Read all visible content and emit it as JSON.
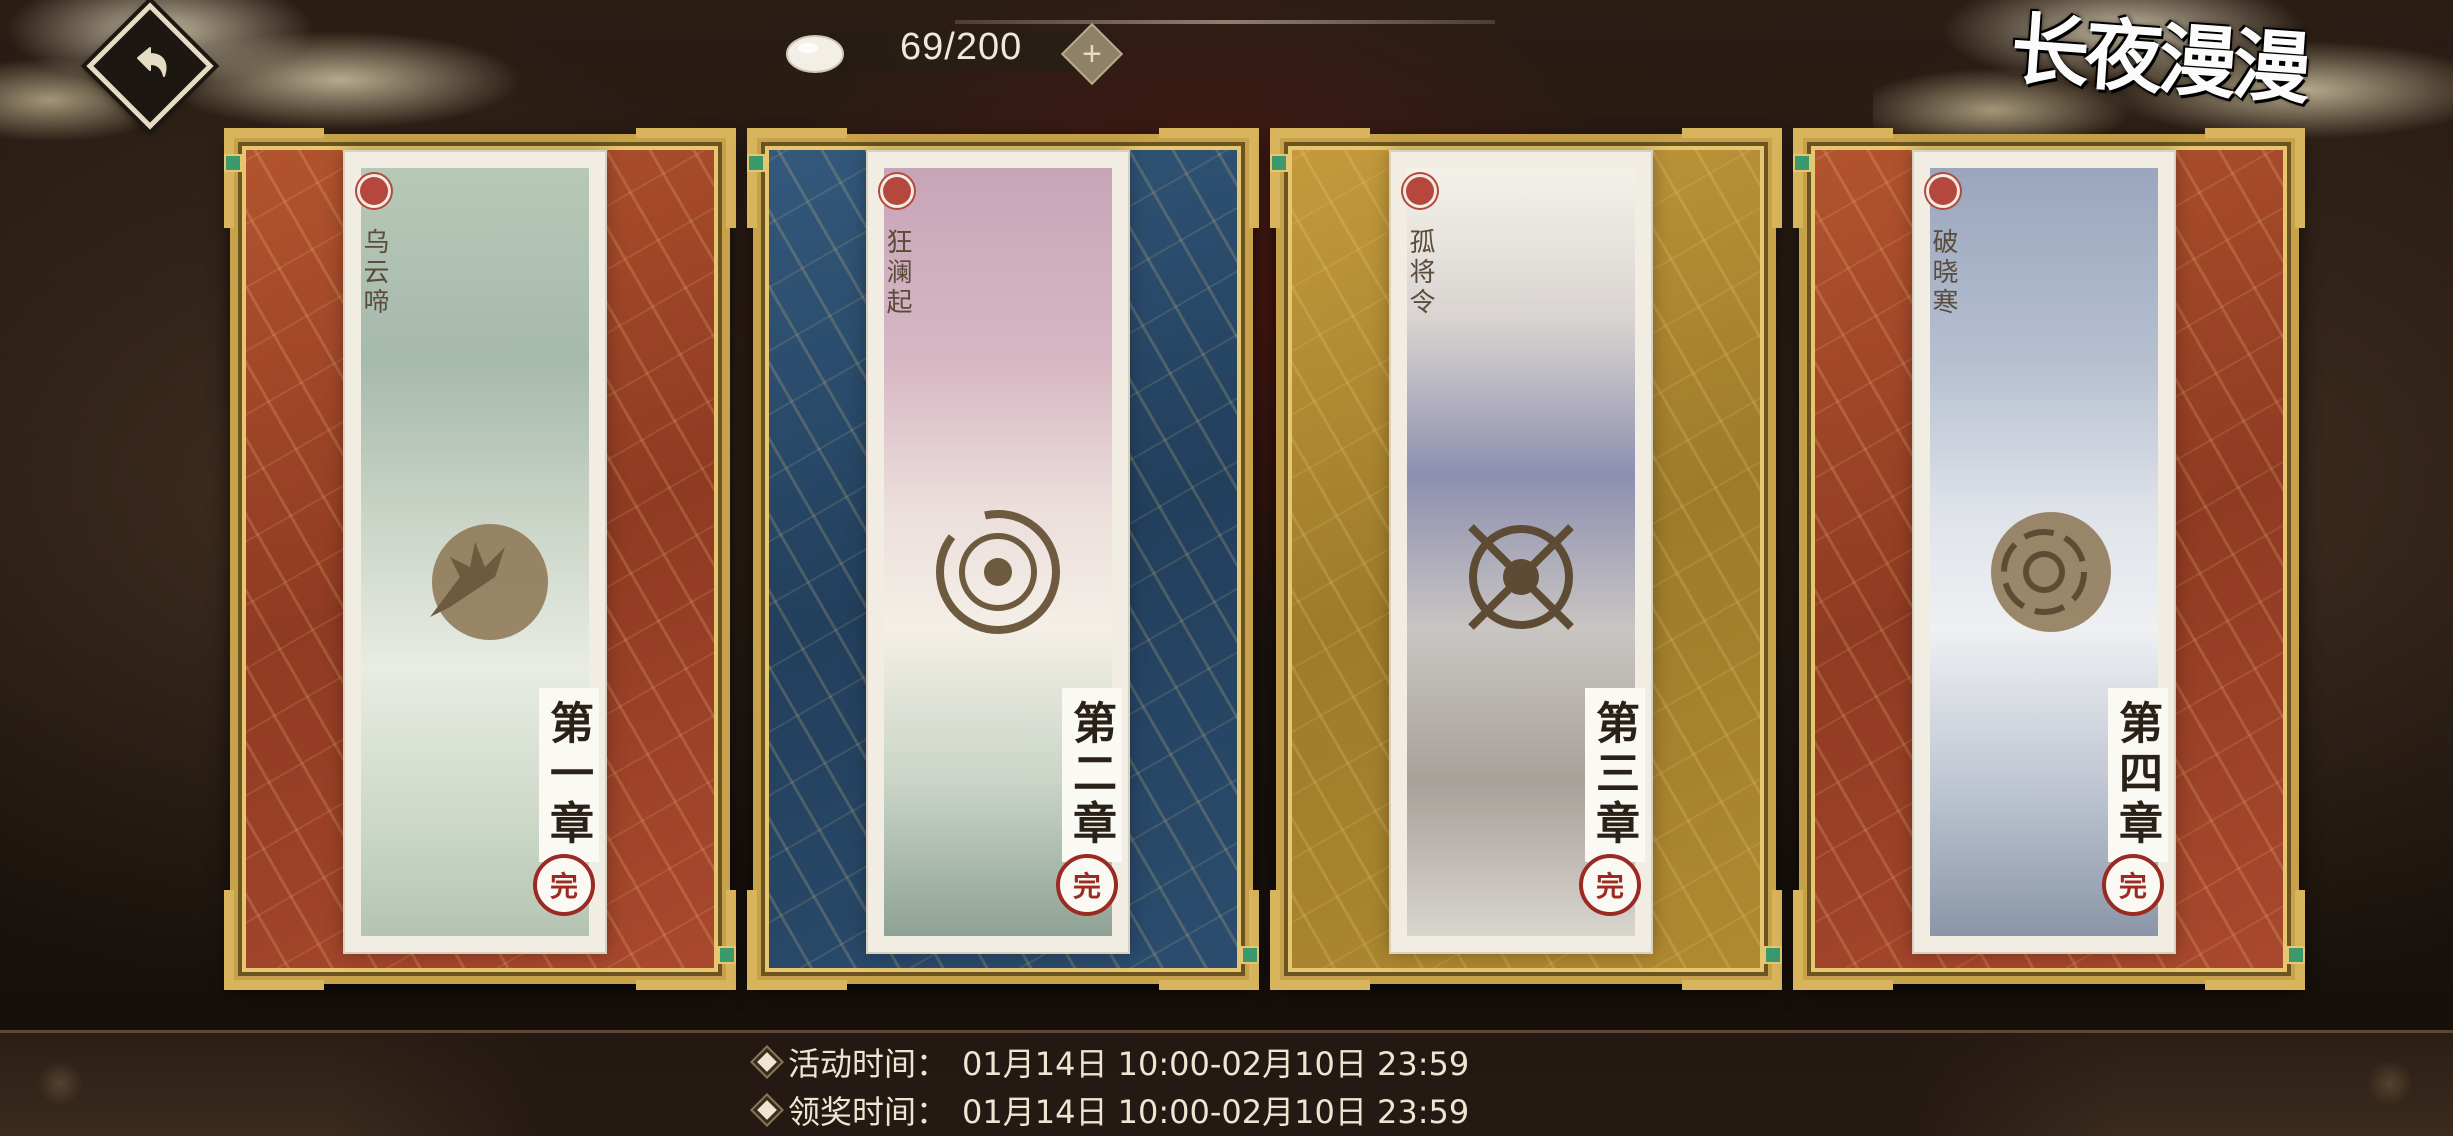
{
  "header": {
    "back_icon": "back-arrow-icon",
    "currency": {
      "icon": "mochi-icon",
      "count": "69/200",
      "add_icon": "plus-icon"
    },
    "event_title": "长夜漫漫"
  },
  "chapters": [
    {
      "subtitle": "乌云啼",
      "chapter_label": "第一章",
      "status": "完",
      "theme": "#a9492e",
      "emblem": "tree-moon-icon"
    },
    {
      "subtitle": "狂澜起",
      "chapter_label": "第二章",
      "status": "完",
      "theme": "#2c4d6e",
      "emblem": "ring-eye-icon"
    },
    {
      "subtitle": "孤将令",
      "chapter_label": "第三章",
      "status": "完",
      "theme": "#b08a32",
      "emblem": "crossed-swords-icon"
    },
    {
      "subtitle": "破晓寒",
      "chapter_label": "第四章",
      "status": "完",
      "theme": "#a9492e",
      "emblem": "swirl-moon-icon"
    }
  ],
  "footer": {
    "activity_label": "活动时间：",
    "activity_value": "01月14日 10:00-02月10日 23:59",
    "reward_label": "领奖时间：",
    "reward_value": "01月14日 10:00-02月10日 23:59"
  }
}
